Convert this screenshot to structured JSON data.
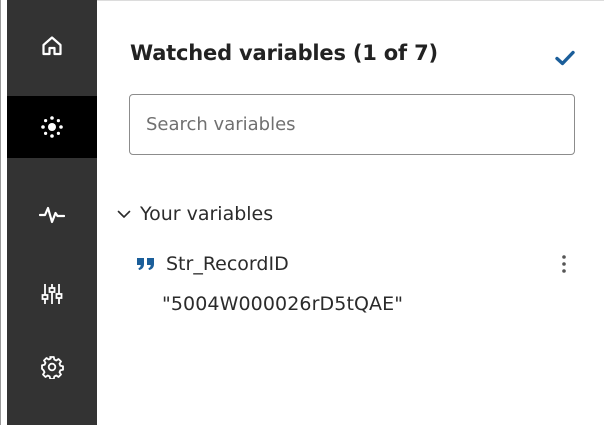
{
  "rail": {
    "items": [
      {
        "icon": "home-icon"
      },
      {
        "icon": "variables-icon",
        "active": true
      },
      {
        "icon": "activity-icon"
      },
      {
        "icon": "sliders-icon"
      },
      {
        "icon": "gear-icon"
      }
    ]
  },
  "panel": {
    "title": "Watched variables (1 of 7)",
    "confirm_icon": "checkmark-icon",
    "search": {
      "placeholder": "Search variables",
      "value": ""
    },
    "groups": [
      {
        "label": "Your variables",
        "expanded": true,
        "variables": [
          {
            "type_icon": "quote-icon",
            "name": "Str_RecordID",
            "value": "\"5004W000026rD5tQAE\""
          }
        ]
      }
    ]
  },
  "colors": {
    "rail_bg": "#333333",
    "rail_active_bg": "#000000",
    "rail_icon": "#ffffff",
    "accent": "#1b5e9a"
  }
}
